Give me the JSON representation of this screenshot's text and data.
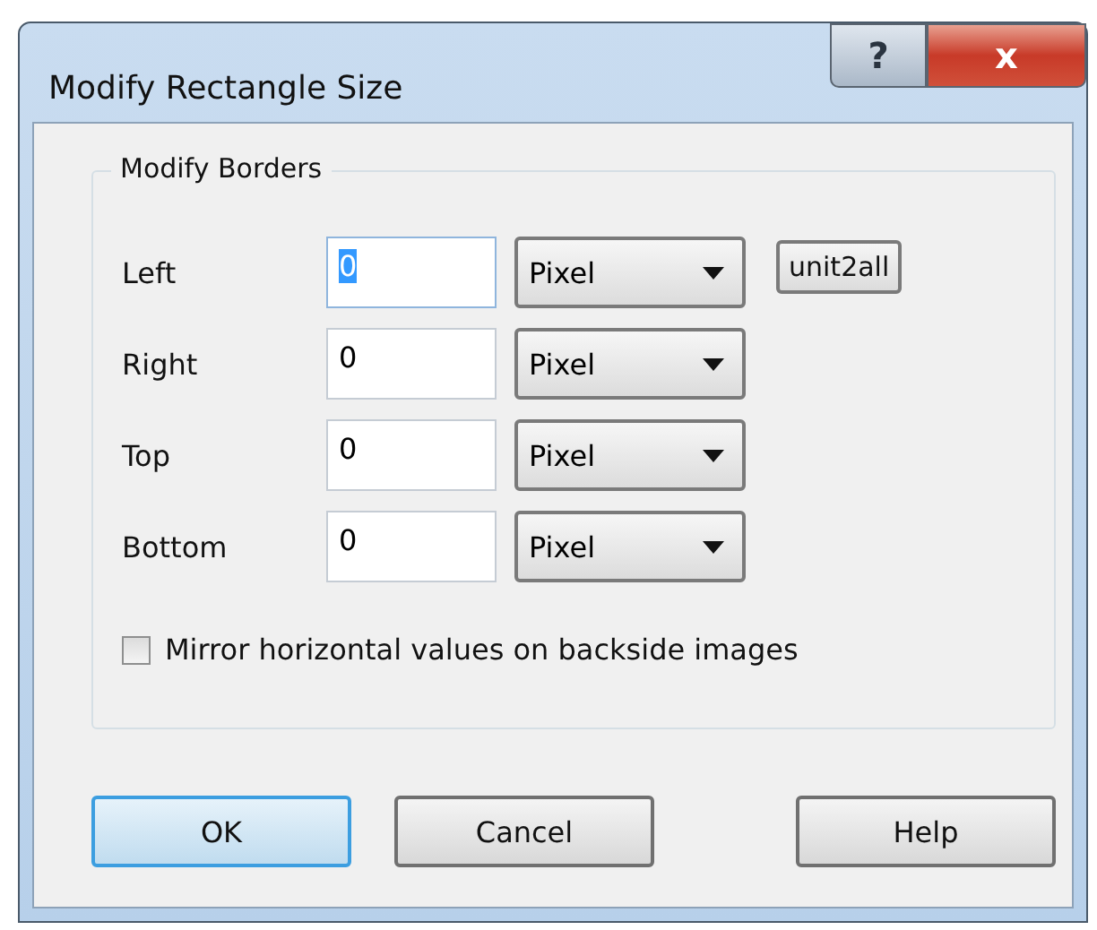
{
  "window": {
    "title": "Modify Rectangle Size",
    "caption_buttons": [
      {
        "kind": "help",
        "label": "?"
      },
      {
        "kind": "close",
        "label": "x"
      }
    ]
  },
  "group": {
    "title": "Modify Borders",
    "rows": [
      {
        "label": "Left",
        "value": "0",
        "focused": true,
        "unit": "Pixel",
        "extra_button": {
          "label": "unit2all"
        }
      },
      {
        "label": "Right",
        "value": "0",
        "focused": false,
        "unit": "Pixel"
      },
      {
        "label": "Top",
        "value": "0",
        "focused": false,
        "unit": "Pixel"
      },
      {
        "label": "Bottom",
        "value": "0",
        "focused": false,
        "unit": "Pixel"
      }
    ],
    "checkbox": {
      "label": "Mirror horizontal values on backside images",
      "checked": false
    }
  },
  "buttons": [
    {
      "label": "OK",
      "default": true
    },
    {
      "label": "Cancel",
      "default": false
    },
    {
      "label": "Help",
      "default": false
    }
  ]
}
